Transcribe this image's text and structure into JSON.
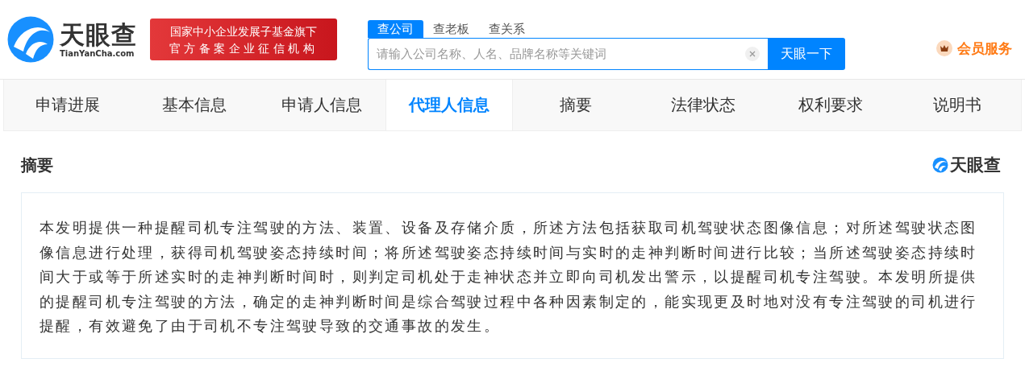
{
  "header": {
    "logo_name": "天眼查",
    "logo_domain": "TianYanCha.com",
    "badge_lines": [
      "国家中小企业发展子基金旗下",
      "官方备案企业征信机构"
    ],
    "search_tabs": [
      {
        "label": "查公司",
        "selected": true
      },
      {
        "label": "查老板",
        "selected": false
      },
      {
        "label": "查关系",
        "selected": false
      }
    ],
    "search": {
      "placeholder": "请输入公司名称、人名、品牌名称等关键词",
      "button": "天眼一下"
    },
    "vip": "会员服务"
  },
  "tabs": [
    {
      "label": "申请进展",
      "selected": false
    },
    {
      "label": "基本信息",
      "selected": false
    },
    {
      "label": "申请人信息",
      "selected": false
    },
    {
      "label": "代理人信息",
      "selected": true
    },
    {
      "label": "摘要",
      "selected": false
    },
    {
      "label": "法律状态",
      "selected": false
    },
    {
      "label": "权利要求",
      "selected": false
    },
    {
      "label": "说明书",
      "selected": false
    }
  ],
  "section": {
    "title": "摘要",
    "watermark_logo": "天眼查",
    "text": "本发明提供一种提醒司机专注驾驶的方法、装置、设备及存储介质，所述方法包括获取司机驾驶状态图像信息；对所述驾驶状态图像信息进行处理，获得司机驾驶姿态持续时间；将所述驾驶姿态持续时间与实时的走神判断时间进行比较；当所述驾驶姿态持续时间大于或等于所述实时的走神判断时间时，则判定司机处于走神状态并立即向司机发出警示，以提醒司机专注驾驶。本发明所提供的提醒司机专注驾驶的方法，确定的走神判断时间是综合驾驶过程中各种因素制定的，能实现更及时地对没有专注驾驶的司机进行提醒，有效避免了由于司机不专注驾驶导致的交通事故的发生。"
  }
}
